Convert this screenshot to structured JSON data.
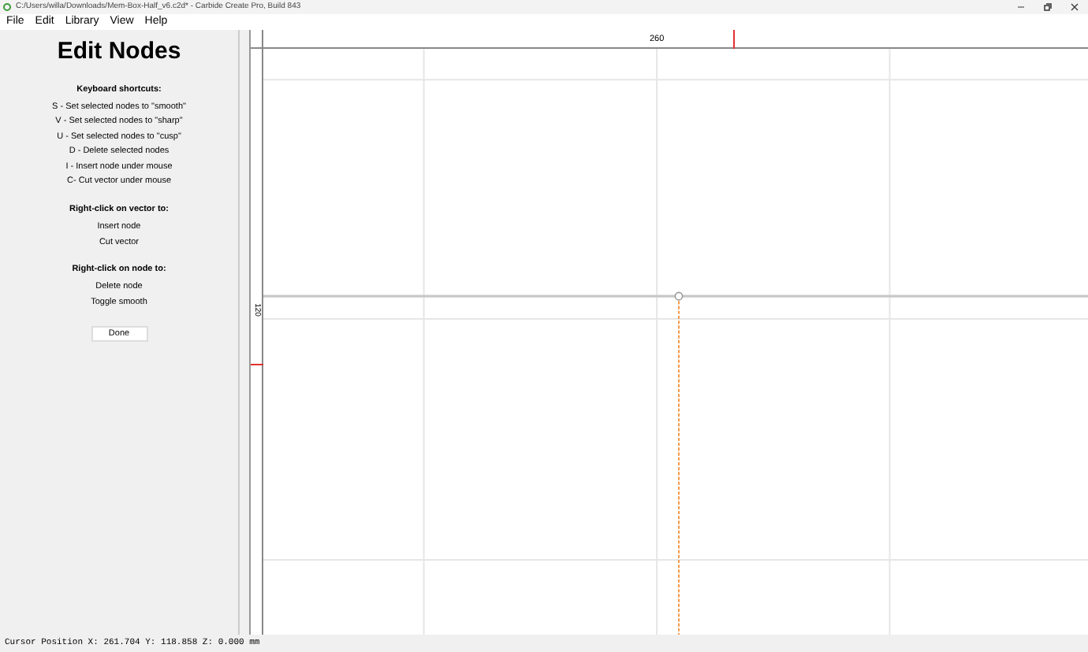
{
  "window": {
    "title": "C:/Users/willa/Downloads/Mem-Box-Half_v6.c2d* - Carbide Create Pro, Build 843"
  },
  "menu": [
    {
      "label": "File"
    },
    {
      "label": "Edit"
    },
    {
      "label": "Library"
    },
    {
      "label": "View"
    },
    {
      "label": "Help"
    }
  ],
  "panel": {
    "title": "Edit Nodes",
    "sections": [
      {
        "heading": "Keyboard shortcuts:",
        "lines": [
          "S - Set selected nodes to \"smooth\"",
          "V - Set selected nodes to \"sharp\"",
          "U - Set selected nodes to \"cusp\"",
          "D - Delete selected nodes",
          "I - Insert node under mouse",
          "C- Cut vector under mouse"
        ]
      },
      {
        "heading": "Right-click on vector to:",
        "lines": [
          "Insert node",
          "Cut vector"
        ]
      },
      {
        "heading": "Right-click on node to:",
        "lines": [
          "Delete node",
          "Toggle smooth"
        ]
      }
    ],
    "button": "Done"
  },
  "rulers": {
    "horizontal_label": "260",
    "vertical_label": "120"
  },
  "status_bar": "Cursor Position X: 261.704 Y: 118.858 Z: 0.000 mm"
}
